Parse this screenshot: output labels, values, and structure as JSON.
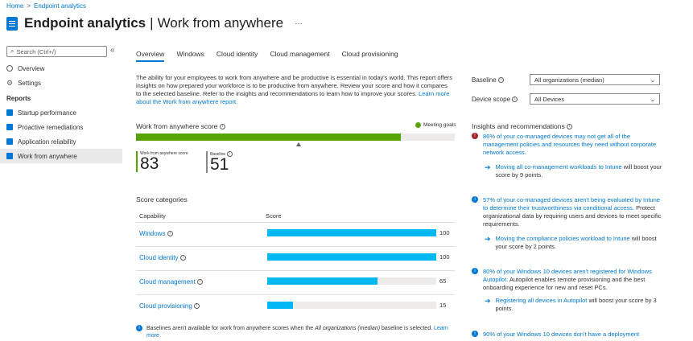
{
  "breadcrumb": {
    "home": "Home",
    "sep": ">",
    "current": "Endpoint analytics"
  },
  "header": {
    "app": "Endpoint analytics",
    "sep": "|",
    "page": "Work from anywhere",
    "more": "···"
  },
  "sidebar": {
    "search_placeholder": "Search (Ctrl+/)",
    "collapse": "«",
    "items": [
      {
        "label": "Overview"
      },
      {
        "label": "Settings"
      }
    ],
    "reports_heading": "Reports",
    "reports": [
      {
        "label": "Startup performance"
      },
      {
        "label": "Proactive remediations"
      },
      {
        "label": "Application reliability"
      },
      {
        "label": "Work from anywhere",
        "selected": true
      }
    ]
  },
  "tabs": [
    "Overview",
    "Windows",
    "Cloud identity",
    "Cloud management",
    "Cloud provisioning"
  ],
  "description": {
    "text": "The ability for your employees to work from anywhere and be productive is essential in today's world. This report offers insights on how prepared your workforce is to be productive from anywhere. Review your score and how it compares to the selected baseline. Refer to the insights and recommendations to learn how to improve your scores.",
    "link": "Learn more about the Work from anywhere report."
  },
  "filters": {
    "baseline_label": "Baseline",
    "baseline_value": "All organizations (median)",
    "scope_label": "Device scope",
    "scope_value": "All Devices"
  },
  "score": {
    "title": "Work from anywhere score",
    "meeting": "Meeting goals",
    "bar_fraction": 0.83,
    "baseline_fraction": 0.51,
    "score_label": "Work from anywhere score",
    "score_value": "83",
    "baseline_label": "Baseline",
    "baseline_value": "51"
  },
  "categories": {
    "title": "Score categories",
    "col_capability": "Capability",
    "col_score": "Score",
    "rows": [
      {
        "name": "Windows",
        "value": 100
      },
      {
        "name": "Cloud identity",
        "value": 100
      },
      {
        "name": "Cloud management",
        "value": 65
      },
      {
        "name": "Cloud provisioning",
        "value": 15
      }
    ]
  },
  "footer": {
    "text1": "Baselines aren't available for work from anywhere scores when the ",
    "em": "All organizations (median)",
    "text2": " baseline is selected. ",
    "link": "Learn more."
  },
  "insights": {
    "title": "Insights and recommendations",
    "i1": {
      "text": "86% of your co-managed devices may not get all of the management policies and resources they need without corporate network access.",
      "rec_link": "Moving all co-management workloads to Intune",
      "rec_rest": " will boost your score by 9 points."
    },
    "i2": {
      "link": "57% of your co-managed devices aren't being evaluated by Intune to determine their trustworthiness via conditional access.",
      "text": " Protect organizational data by requiring users and devices to meet specific requirements.",
      "rec_link": "Moving the compliance policies workload to Intune",
      "rec_rest": " will boost your score by 2 points."
    },
    "i3": {
      "link": "80% of your Windows 10 devices aren't registered for Windows Autopilot.",
      "text": " Autopilot enables remote provisioning and the best onboarding experience for new and reset PCs.",
      "rec_link": "Registering all devices in Autopilot",
      "rec_rest": " will boost your score by 3 points."
    },
    "i4": {
      "link": "90% of your Windows 10 devices don't have a deployment"
    }
  },
  "colors": {
    "accent": "#0078d4",
    "score_green": "#57a300",
    "category_bar": "#00b7f1",
    "error": "#a4262c"
  }
}
